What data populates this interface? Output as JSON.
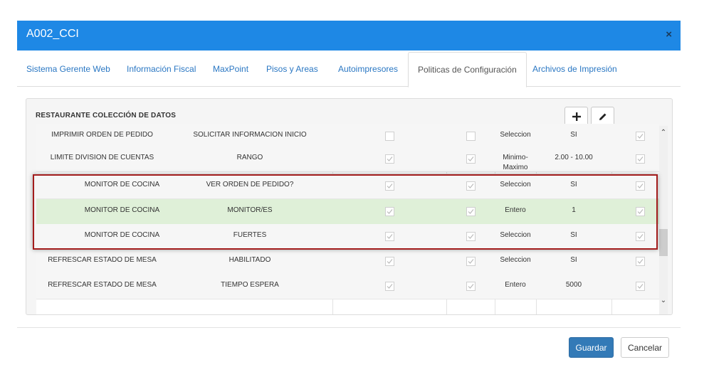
{
  "header": {
    "title": "A002_CCI",
    "close": "×"
  },
  "tabs": [
    {
      "label": "Sistema Gerente Web",
      "active": false
    },
    {
      "label": "Información Fiscal",
      "active": false
    },
    {
      "label": "MaxPoint",
      "active": false
    },
    {
      "label": "Pisos y Areas",
      "active": false
    },
    {
      "label": "Autoimpresores",
      "active": false
    },
    {
      "label": "Politicas de Configuración",
      "active": true
    },
    {
      "label": "Archivos de Impresión",
      "active": false
    }
  ],
  "panel": {
    "title": "RESTAURANTE COLECCIÓN DE DATOS",
    "add_icon": "plus-icon",
    "edit_icon": "pencil-icon"
  },
  "rows": [
    {
      "c1": "IMPRIMIR ORDEN DE PEDIDO",
      "c2": "SOLICITAR INFORMACION INICIO",
      "cb1": false,
      "cb2": false,
      "type": "Seleccion",
      "value": "SI",
      "cb3": true,
      "selected": false
    },
    {
      "c1": "LIMITE DIVISION DE CUENTAS",
      "c2": "RANGO",
      "cb1": true,
      "cb2": true,
      "type": "Minimo-",
      "type2": "Maximo",
      "value": "2.00 - 10.00",
      "cb3": true,
      "selected": false
    },
    {
      "c1": "MONITOR DE COCINA",
      "c2": "VER ORDEN DE PEDIDO?",
      "cb1": true,
      "cb2": true,
      "type": "Seleccion",
      "value": "SI",
      "cb3": true,
      "selected": false
    },
    {
      "c1": "MONITOR DE COCINA",
      "c2": "MONITOR/ES",
      "cb1": true,
      "cb2": true,
      "type": "Entero",
      "value": "1",
      "cb3": true,
      "selected": true
    },
    {
      "c1": "MONITOR DE COCINA",
      "c2": "FUERTES",
      "cb1": true,
      "cb2": true,
      "type": "Seleccion",
      "value": "SI",
      "cb3": true,
      "selected": false
    },
    {
      "c1": "REFRESCAR ESTADO DE MESA",
      "c2": "HABILITADO",
      "cb1": true,
      "cb2": true,
      "type": "Seleccion",
      "value": "SI",
      "cb3": true,
      "selected": false
    },
    {
      "c1": "REFRESCAR ESTADO DE MESA",
      "c2": "TIEMPO ESPERA",
      "cb1": true,
      "cb2": true,
      "type": "Entero",
      "value": "5000",
      "cb3": true,
      "selected": false
    }
  ],
  "footer": {
    "save_label": "Guardar",
    "cancel_label": "Cancelar"
  },
  "colors": {
    "header": "#1e88e5",
    "primary_button": "#337ab7",
    "selected_row": "#dff0d8",
    "highlight_border": "#a31c1c"
  }
}
